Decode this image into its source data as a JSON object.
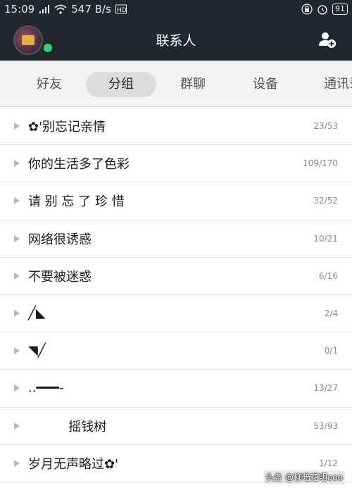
{
  "status_bar": {
    "time": "15:09",
    "speed": "547 B/s",
    "battery": "91"
  },
  "header": {
    "title": "联系人"
  },
  "tabs": [
    {
      "label": "好友",
      "active": false
    },
    {
      "label": "分组",
      "active": true
    },
    {
      "label": "群聊",
      "active": false
    },
    {
      "label": "设备",
      "active": false
    },
    {
      "label": "通讯录",
      "active": false
    }
  ],
  "groups": [
    {
      "name": "✿'别忘记亲情",
      "count": "23/53"
    },
    {
      "name": "你的生活多了色彩",
      "count": "109/170"
    },
    {
      "name": "请 别 忘 了 珍 惜",
      "count": "32/52"
    },
    {
      "name": "网络很诱惑",
      "count": "10/21"
    },
    {
      "name": "不要被迷惑",
      "count": "6/16"
    },
    {
      "name": "╱◣",
      "count": "2/4"
    },
    {
      "name": "◥╱",
      "count": "0/1"
    },
    {
      "name": "..━━━-",
      "count": "13/27"
    },
    {
      "name": "          摇钱树",
      "count": "53/93"
    },
    {
      "name": "岁月无声略过✿'",
      "count": "1/12"
    }
  ],
  "watermark": "头条 @柳暗花明ooo",
  "colors": {
    "header_bg": "#23262c",
    "online": "#2dd36f",
    "tab_active_bg": "#dcdcdc"
  }
}
